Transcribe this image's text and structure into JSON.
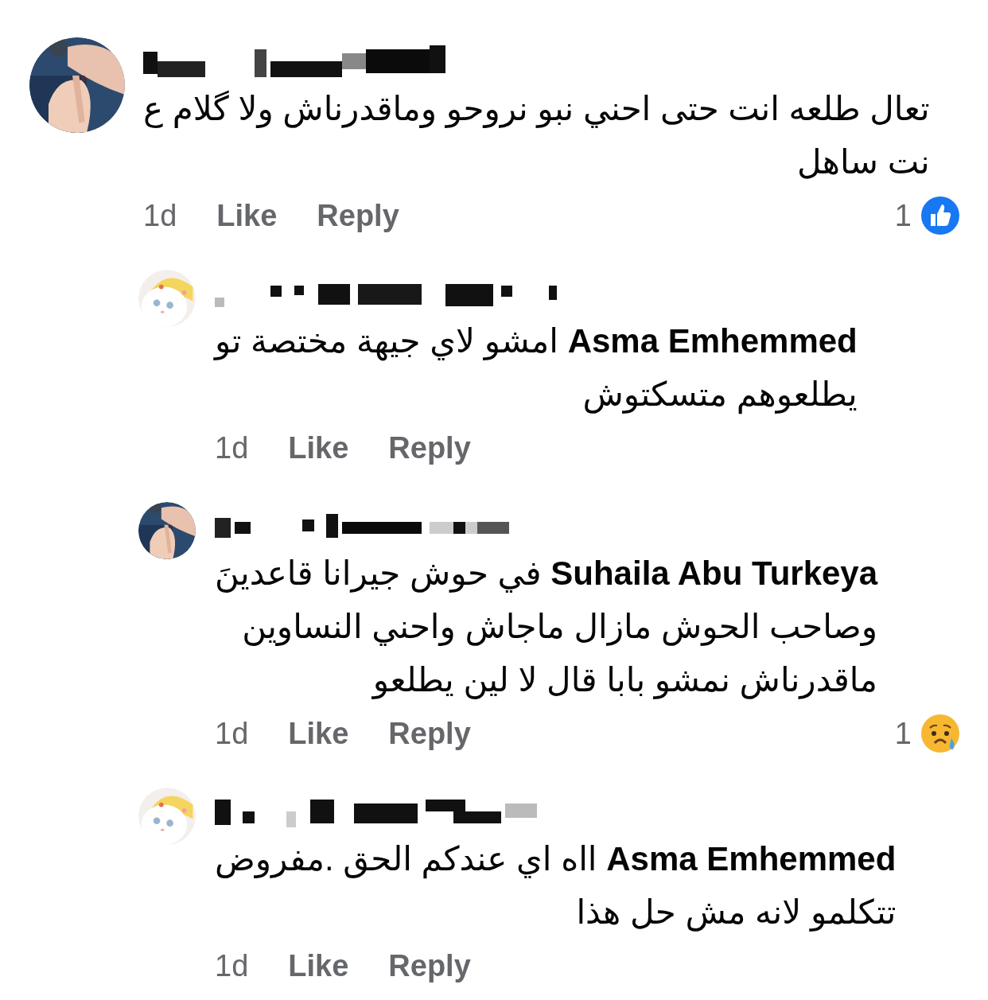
{
  "comments": [
    {
      "reply": false,
      "lines": [
        "تعال طلعه انت حتى احني نبو نروحو وماقدرناش ولا گلام ع",
        "نت ساهل"
      ],
      "time": "1d",
      "like": "Like",
      "reply_label": "Reply",
      "reaction": {
        "count": "1",
        "kind": "like"
      }
    },
    {
      "reply": true,
      "lines": [
        "**Asma Emhemmed**  امشو لاي جيهة مختصة تو",
        "يطلعوهم متسكتوش"
      ],
      "time": "1d",
      "like": "Like",
      "reply_label": "Reply"
    },
    {
      "reply": true,
      "lines": [
        "**Suhaila Abu Turkeya** في حوش جيرانا قاعدينَ",
        "وصاحب الحوش مازال ماجاش واحني النساوين",
        "ماقدرناش نمشو بابا قال لا لين يطلعو"
      ],
      "time": "1d",
      "like": "Like",
      "reply_label": "Reply",
      "reaction": {
        "count": "1",
        "kind": "sad"
      }
    },
    {
      "reply": true,
      "lines": [
        "**Asma Emhemmed**  ااه اي عندكم الحق .مفروض",
        "تتكلمو لانه مش حل هذا"
      ],
      "time": "1d",
      "like": "Like",
      "reply_label": "Reply"
    }
  ]
}
